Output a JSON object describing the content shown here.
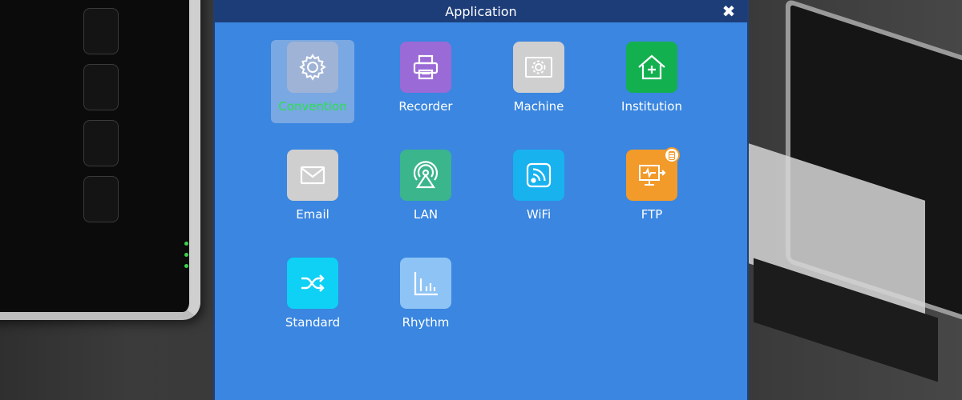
{
  "window": {
    "title": "Application"
  },
  "apps": [
    {
      "id": "convention",
      "label": "Convention",
      "icon": "gear-icon",
      "color": "#9fb3d6",
      "selected": true
    },
    {
      "id": "recorder",
      "label": "Recorder",
      "icon": "printer-icon",
      "color": "#9a6ad6",
      "selected": false
    },
    {
      "id": "machine",
      "label": "Machine",
      "icon": "machine-settings-icon",
      "color": "#cfcfcf",
      "selected": false
    },
    {
      "id": "institution",
      "label": "Institution",
      "icon": "hospital-icon",
      "color": "#13b04f",
      "selected": false
    },
    {
      "id": "email",
      "label": "Email",
      "icon": "envelope-icon",
      "color": "#cfcfcf",
      "selected": false
    },
    {
      "id": "lan",
      "label": "LAN",
      "icon": "network-broadcast-icon",
      "color": "#3ab58c",
      "selected": false
    },
    {
      "id": "wifi",
      "label": "WiFi",
      "icon": "wifi-icon",
      "color": "#18b2ef",
      "selected": false
    },
    {
      "id": "ftp",
      "label": "FTP",
      "icon": "ftp-monitor-icon",
      "color": "#f29a2a",
      "selected": false
    },
    {
      "id": "standard",
      "label": "Standard",
      "icon": "shuffle-icon",
      "color": "#0fd0f5",
      "selected": false
    },
    {
      "id": "rhythm",
      "label": "Rhythm",
      "icon": "bar-chart-icon",
      "color": "#8ec3f5",
      "selected": false
    }
  ],
  "colors": {
    "titlebar": "#1d3d79",
    "window_bg": "#3a86e0",
    "selected_label": "#29e24a"
  }
}
